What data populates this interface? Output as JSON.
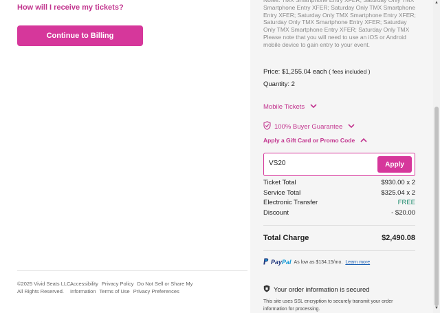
{
  "help": {
    "label": "How will I receive my tickets?"
  },
  "billing": {
    "button_label": "Continue to Billing"
  },
  "footer": {
    "copyright": "©2025 Vivid Seats LLC. All Rights Reserved.",
    "links": [
      "Accessibility",
      "Privacy Policy",
      "Do Not Sell or Share My Information",
      "Terms of Use",
      "Privacy Preferences"
    ]
  },
  "order": {
    "notes": "Notes: TMX Smartphone Entry XFER; Saturday Only TMX Smartphone Entry XFER; Saturday Only TMX Smartphone Entry XFER; Saturday Only TMX Smartphone Entry XFER; Saturday Only TMX Smartphone Entry XFER; Saturday Only TMX Smartphone Entry XFER; Saturday Only TMX Please note that you will need to use an iOS or Android mobile device to gain entry to your event.",
    "price_label": "Price:",
    "price_value": "$1,255.04 each",
    "price_fees": "( fees included )",
    "quantity_label": "Quantity:",
    "quantity_value": "2",
    "mobile_tickets": "Mobile Tickets",
    "guarantee": "100% Buyer Guarantee",
    "promo_toggle": "Apply a Gift Card or Promo Code",
    "promo_value": "VS20",
    "apply_label": "Apply",
    "summary": [
      {
        "label": "Ticket Total",
        "value": "$930.00 x 2"
      },
      {
        "label": "Service Total",
        "value": "$325.04 x 2"
      },
      {
        "label": "Electronic Transfer",
        "value": "FREE"
      },
      {
        "label": "Discount",
        "value": "- $20.00"
      }
    ],
    "total_label": "Total Charge",
    "total_value": "$2,490.08",
    "paypal_brand_1": "Pay",
    "paypal_brand_2": "Pal",
    "paypal_text": "As low as $134.15/mo.",
    "paypal_learn": "Learn more",
    "secure_title": "Your order information is secured",
    "secure_desc": "This site uses SSL encryption to securely transmit your order information for processing."
  },
  "colors": {
    "accent": "#d6379b",
    "link": "#c2348e",
    "free": "#1a8a6b"
  }
}
